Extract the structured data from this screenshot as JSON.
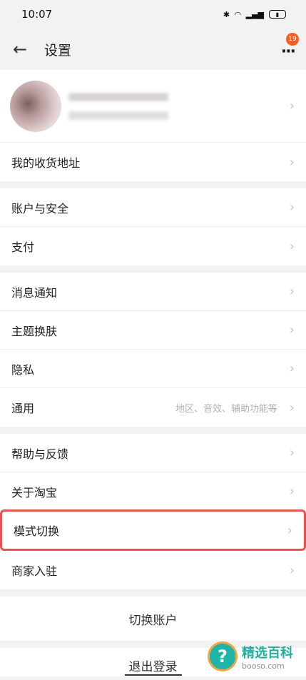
{
  "status_bar": {
    "time": "10:07",
    "icons": [
      "bluetooth-icon",
      "wifi-icon",
      "signal-icon",
      "battery-icon"
    ]
  },
  "header": {
    "title": "设置",
    "badge_count": "19"
  },
  "profile": {
    "name_obscured": true
  },
  "groups": [
    {
      "items": [
        {
          "label": "我的收货地址"
        }
      ]
    },
    {
      "items": [
        {
          "label": "账户与安全"
        },
        {
          "label": "支付"
        }
      ]
    },
    {
      "items": [
        {
          "label": "消息通知"
        },
        {
          "label": "主题换肤"
        },
        {
          "label": "隐私"
        },
        {
          "label": "通用",
          "extra": "地区、音效、辅助功能等"
        }
      ]
    },
    {
      "items": [
        {
          "label": "帮助与反馈"
        },
        {
          "label": "关于淘宝"
        },
        {
          "label": "模式切换",
          "highlighted": true
        },
        {
          "label": "商家入驻"
        }
      ]
    }
  ],
  "switch_account": "切换账户",
  "logout": "退出登录",
  "watermark": {
    "title": "精选百科",
    "url": "booso.com"
  },
  "colors": {
    "highlight": "#e65252",
    "badge": "#ff5a1f",
    "background": "#f2f2f2"
  }
}
